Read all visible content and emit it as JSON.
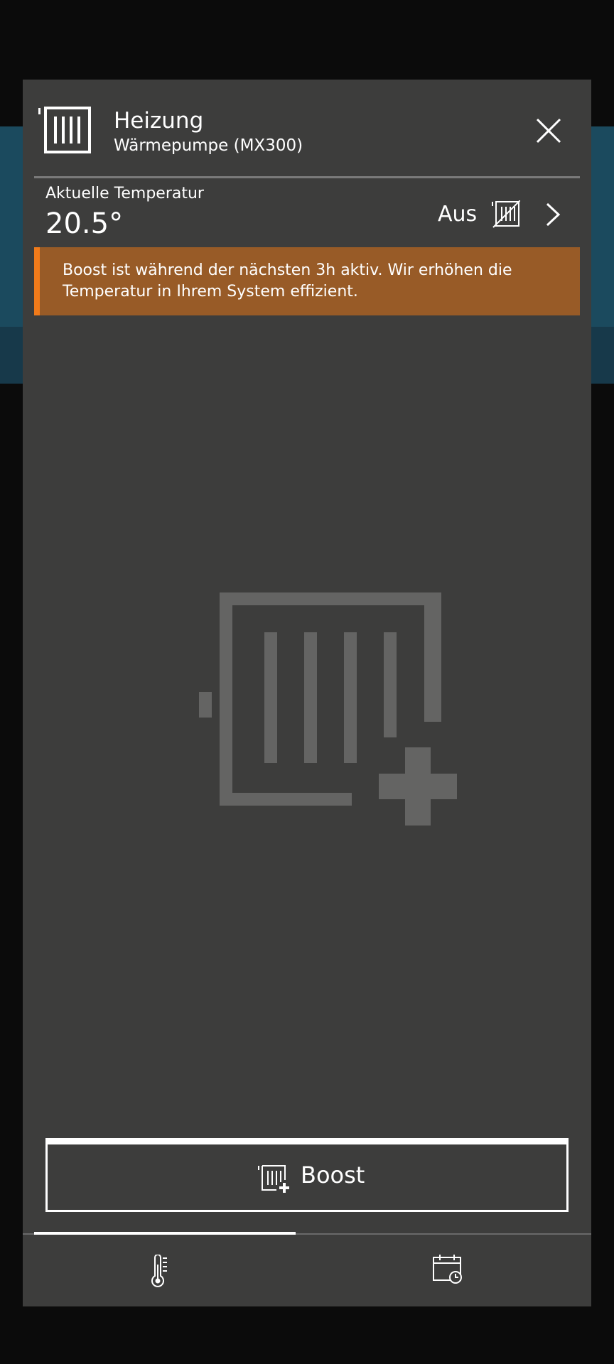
{
  "header": {
    "title": "Heizung",
    "subtitle": "Wärmepumpe (MX300)",
    "icon": "radiator-icon",
    "close_icon": "close-icon"
  },
  "current": {
    "label": "Aktuelle Temperatur",
    "value": "20.5°",
    "mode_label": "Aus",
    "mode_icon": "heating-off-icon",
    "chevron_icon": "chevron-right-icon"
  },
  "banner": {
    "text": "Boost ist während der nächsten 3h aktiv. Wir erhöhen die Temperatur in Ihrem System effizient."
  },
  "illustration": {
    "icon": "radiator-add-icon"
  },
  "boost": {
    "label": "Boost",
    "icon": "radiator-boost-icon"
  },
  "tabs": [
    {
      "icon": "thermometer-icon",
      "active": true
    },
    {
      "icon": "calendar-clock-icon",
      "active": false
    }
  ],
  "colors": {
    "modal_bg": "#3d3d3c",
    "banner_bg": "#985b27",
    "banner_accent": "#f07a1a",
    "text": "#ffffff",
    "illustration": "#646463"
  }
}
